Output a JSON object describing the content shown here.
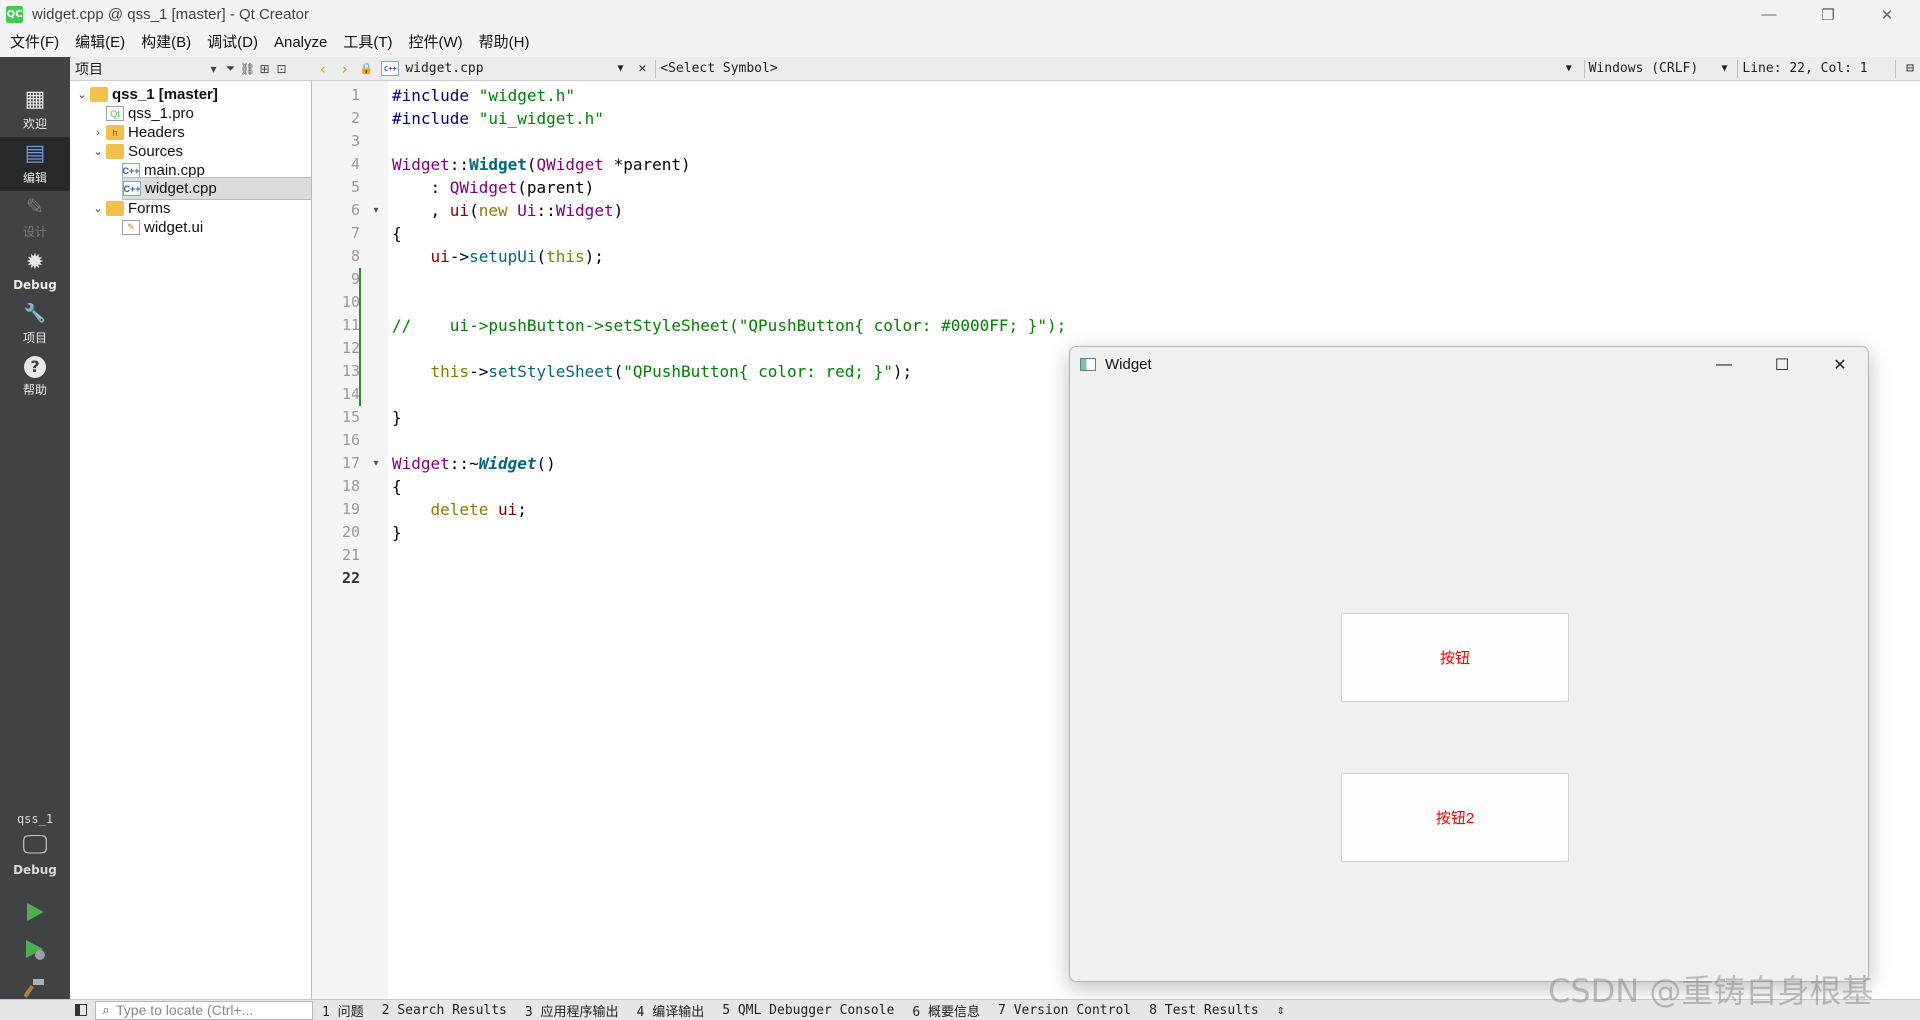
{
  "window": {
    "title": "widget.cpp @ qss_1 [master] - Qt Creator",
    "app_icon_text": "QC",
    "minimize": "—",
    "restore": "❐",
    "close": "✕"
  },
  "menubar": [
    "文件(F)",
    "编辑(E)",
    "构建(B)",
    "调试(D)",
    "Analyze",
    "工具(T)",
    "控件(W)",
    "帮助(H)"
  ],
  "modes": [
    {
      "label": "欢迎",
      "icon": "grid-icon",
      "glyph": "▦"
    },
    {
      "label": "编辑",
      "icon": "edit-icon",
      "glyph": "▤"
    },
    {
      "label": "设计",
      "icon": "pencil-icon",
      "glyph": "✎"
    },
    {
      "label": "Debug",
      "icon": "bug-icon",
      "glyph": "✹"
    },
    {
      "label": "项目",
      "icon": "wrench-icon",
      "glyph": "🔧"
    },
    {
      "label": "帮助",
      "icon": "help-icon",
      "glyph": "?"
    }
  ],
  "kit": {
    "name": "qss_1",
    "mode": "Debug"
  },
  "project_pane": {
    "header": "项目",
    "tree": [
      {
        "label": "qss_1 [master]",
        "depth": 0,
        "expanded": true,
        "type": "project"
      },
      {
        "label": "qss_1.pro",
        "depth": 1,
        "type": "pro"
      },
      {
        "label": "Headers",
        "depth": 1,
        "expanded": false,
        "type": "folder"
      },
      {
        "label": "Sources",
        "depth": 1,
        "expanded": true,
        "type": "folder"
      },
      {
        "label": "main.cpp",
        "depth": 2,
        "type": "cpp"
      },
      {
        "label": "widget.cpp",
        "depth": 2,
        "type": "cpp",
        "selected": true
      },
      {
        "label": "Forms",
        "depth": 1,
        "expanded": true,
        "type": "folder"
      },
      {
        "label": "widget.ui",
        "depth": 2,
        "type": "ui"
      }
    ]
  },
  "editor_toolbar": {
    "file": "widget.cpp",
    "symbol": "<Select Symbol>",
    "encoding": "Windows (CRLF)",
    "position": "Line: 22, Col: 1"
  },
  "editor": {
    "current_line": 22,
    "line_numbers": [
      "1",
      "2",
      "3",
      "4",
      "5",
      "6",
      "7",
      "8",
      "9",
      "10",
      "11",
      "12",
      "13",
      "14",
      "15",
      "16",
      "17",
      "18",
      "19",
      "20",
      "21",
      "22"
    ],
    "folds": {
      "6": "▾",
      "17": "▾"
    },
    "code": {
      "l1_pp": "#include",
      "l1_str": " \"widget.h\"",
      "l2_pp": "#include",
      "l2_str": " \"ui_widget.h\"",
      "l4_cls": "Widget",
      "l4_sep": "::",
      "l4_fn": "Widget",
      "l4_p1": "(",
      "l4_type": "QWidget",
      "l4_rest": " *parent)",
      "l5_pre": "    : ",
      "l5_cls": "QWidget",
      "l5_rest": "(parent)",
      "l6_pre": "    , ",
      "l6_mem": "ui",
      "l6_p": "(",
      "l6_kw": "new",
      "l6_sp": " ",
      "l6_ns": "Ui",
      "l6_sep": "::",
      "l6_cls": "Widget",
      "l6_end": ")",
      "l7": "{",
      "l8_pre": "    ",
      "l8_mem": "ui",
      "l8_arrow": "->",
      "l8_fn": "setupUi",
      "l8_p": "(",
      "l8_kw": "this",
      "l8_end": ");",
      "l11_cmt": "//    ui->pushButton->setStyleSheet(\"QPushButton{ color: #0000FF; }\");",
      "l13_pre": "    ",
      "l13_kw": "this",
      "l13_arrow": "->",
      "l13_fn": "setStyleSheet",
      "l13_p": "(",
      "l13_str": "\"QPushButton{ color: red; }\"",
      "l13_end": ");",
      "l15": "}",
      "l17_cls": "Widget",
      "l17_sep": "::~",
      "l17_fn": "Widget",
      "l17_end": "()",
      "l18": "{",
      "l19_pre": "    ",
      "l19_kw": "delete",
      "l19_sp": " ",
      "l19_mem": "ui",
      "l19_end": ";",
      "l20": "}"
    }
  },
  "widget_window": {
    "title": "Widget",
    "minimize": "—",
    "maximize": "☐",
    "close": "✕",
    "button1": "按钮",
    "button2": "按钮2",
    "button_text_color": "#ff0000"
  },
  "statusbar": {
    "locator_placeholder": "Type to locate (Ctrl+...",
    "tabs": [
      "1 问题",
      "2 Search Results",
      "3 应用程序输出",
      "4 编译输出",
      "5 QML Debugger Console",
      "6 概要信息",
      "7 Version Control",
      "8 Test Results"
    ],
    "more": "⇕"
  },
  "watermark": "CSDN @重铸自身根基",
  "colors": {
    "modebar": "#404244",
    "mode_active": "#262829",
    "keyword": "#808000",
    "string": "#008000",
    "class": "#800080",
    "function": "#00677c"
  }
}
